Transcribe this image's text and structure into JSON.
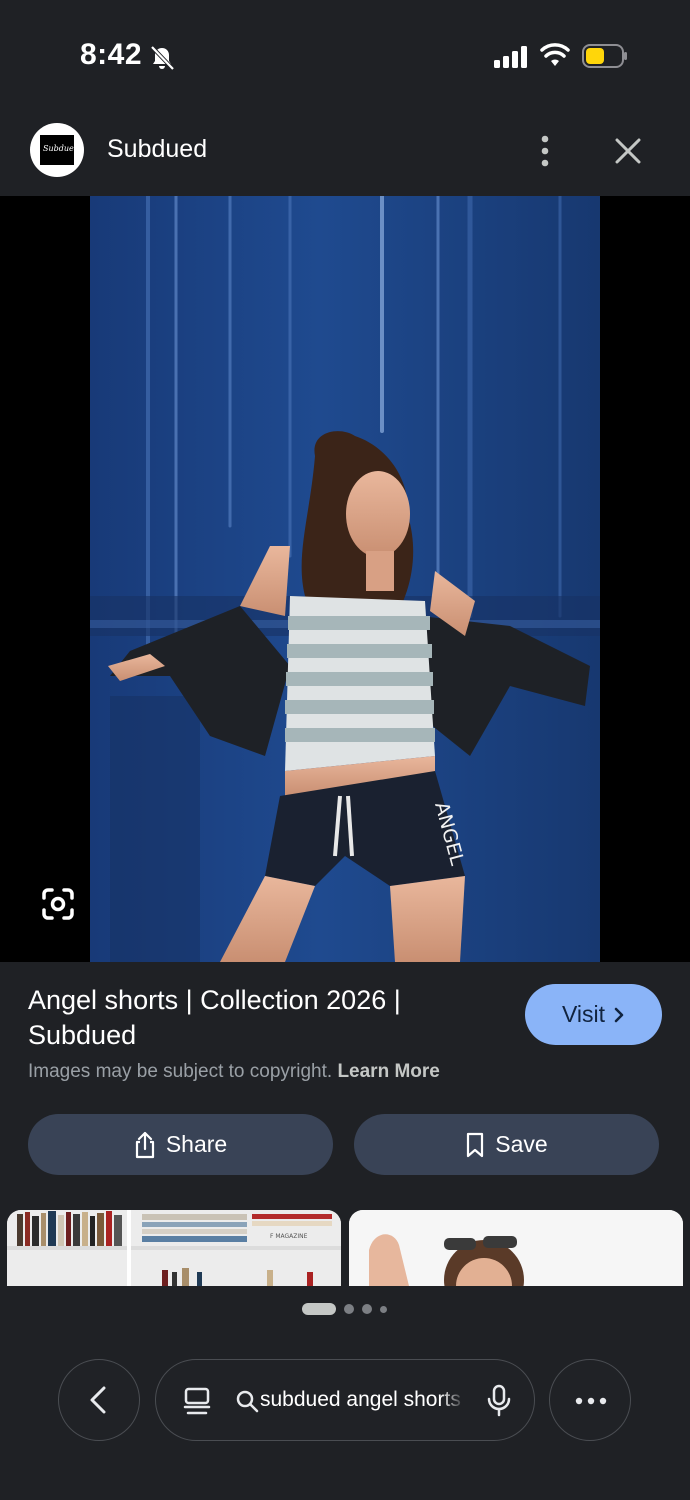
{
  "status_bar": {
    "time": "8:42",
    "icons": [
      "bell-slash-icon",
      "signal-icon",
      "wifi-icon",
      "battery-icon"
    ],
    "battery_color": "#ffd60a"
  },
  "header": {
    "source_name": "Subdued",
    "logo_text": "Subdued",
    "icons": [
      "more-vert-icon",
      "close-icon"
    ]
  },
  "result": {
    "title": "Angel shorts | Collection 2026 | Subdued",
    "visit_label": "Visit",
    "copyright_text": "Images may be subject to copyright.",
    "learn_more_label": "Learn More",
    "photo_print_text": "ANGEL"
  },
  "actions": {
    "share_label": "Share",
    "save_label": "Save"
  },
  "thumbnails": {
    "thumb1_text": "F MAGAZINE"
  },
  "pagination": {
    "current": 1,
    "total": 4
  },
  "bottom_bar": {
    "query": "subdued angel shorts",
    "icons": [
      "back-icon",
      "tabs-icon",
      "search-icon",
      "mic-icon",
      "more-horiz-icon"
    ]
  },
  "colors": {
    "background": "#1f2125",
    "visit_button": "#8ab4f8",
    "pill_button": "#394356",
    "door_blue": "#1c3d7a"
  }
}
